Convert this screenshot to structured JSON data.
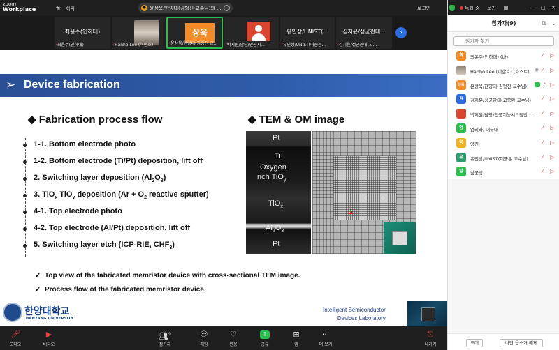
{
  "app": {
    "logo_small": "zoom",
    "logo_big": "Workplace"
  },
  "topbar": {
    "meeting_label": "회의",
    "share_pill_text": "윤상욱/한양대(김형진 교수님)의 ...",
    "login_label": "로그인",
    "recording_label": "녹화 중",
    "view_label": "보기"
  },
  "thumbnails": [
    {
      "big": "최윤주(인하대)",
      "caption": "최윤주(인하대)"
    },
    {
      "big": "",
      "caption": "Hanho Lee (이한호)"
    },
    {
      "big": "상욱",
      "caption": "윤상욱/한양대(김형진 교..."
    },
    {
      "big": "",
      "caption": "박지원/담당/인공지..."
    },
    {
      "big": "유민상/UNIST(...",
      "caption": "유민상/UNIST(이종은..."
    },
    {
      "big": "김지윤/성균관대...",
      "caption": "김지윤/성균관대(고..."
    }
  ],
  "slide": {
    "banner_title": "Device fabrication",
    "left_heading": "Fabrication process flow",
    "right_heading": "TEM & OM image",
    "steps": [
      {
        "pre": "1-1. Bottom electrode photo"
      },
      {
        "pre": "1-2. Bottom electrode (Ti/Pt) deposition, lift off"
      },
      {
        "pre": "2. Switching layer deposition (Al",
        "s1": "2",
        "m": "O",
        "s2": "3",
        "post": ")"
      },
      {
        "pre": "3. TiO",
        "s1": "x",
        "m": " TiO",
        "s2": "y",
        "post": " deposition (Ar + O",
        "s3": "2",
        "post2": " reactive sputter)"
      },
      {
        "pre": "4-1. Top electrode photo"
      },
      {
        "pre": "4-2. Top electrode (Al/Pt) deposition, lift off"
      },
      {
        "pre": "5. Switching layer etch (ICP-RIE, CHF",
        "s1": "3",
        "post": ")"
      }
    ],
    "tem_labels": {
      "pt_top": "Pt",
      "ti": "Ti",
      "oxygen": "Oxygen",
      "rich": "rich TiO",
      "rich_sub": "y",
      "tiox": "TiO",
      "tiox_sub": "x",
      "al2o3_a": "Al",
      "al2o3_s1": "2",
      "al2o3_b": "O",
      "al2o3_s2": "3",
      "pt_bottom": "Pt"
    },
    "checks": [
      "Top view of the fabricated memristor device with cross-sectional TEM image.",
      "Process flow of the fabricated memristor device."
    ],
    "footer": {
      "univ_ko": "한양대학교",
      "univ_en": "HANYANG UNIVERSITY",
      "lab_line1": "Intelligent Semiconductor",
      "lab_line2": "Devices Laboratory"
    }
  },
  "toolbar": {
    "audio": "오디오",
    "video": "비디오",
    "participants": "참가자",
    "participants_count": "9",
    "chat": "채팅",
    "react": "반응",
    "share": "공유",
    "apps": "앱",
    "more": "더 보기",
    "leave": "나가기"
  },
  "panel": {
    "title": "참가자(9)",
    "search_placeholder": "참가자 찾기",
    "participants": [
      {
        "initial": "최",
        "name": "최윤주(인하대) (나)",
        "color": "#f28c28"
      },
      {
        "initial": "",
        "name": "Hanho Lee (이한호) (호스트)",
        "color": "#b9a58f"
      },
      {
        "initial": "상욱",
        "name": "윤상욱/한양대(김형진 교수님)",
        "color": "#f28c28"
      },
      {
        "initial": "김",
        "name": "김지윤/성균관대(고종환 교수님)",
        "color": "#2d6cdf"
      },
      {
        "initial": "",
        "name": "박지원/담당/인공지능시스템반...",
        "color": "#d9452e"
      },
      {
        "initial": "엄",
        "name": "엄리라, 대구대",
        "color": "#2cbf4e"
      },
      {
        "initial": "양",
        "name": "양진",
        "color": "#f2b01e"
      },
      {
        "initial": "유",
        "name": "유민상/UNIST(이종은 교수님)",
        "color": "#2d9d6f"
      },
      {
        "initial": "남",
        "name": "남궁성",
        "color": "#2cbf4e"
      }
    ],
    "invite_label": "초대",
    "mute_self_label": "나만 음소거 해제"
  }
}
